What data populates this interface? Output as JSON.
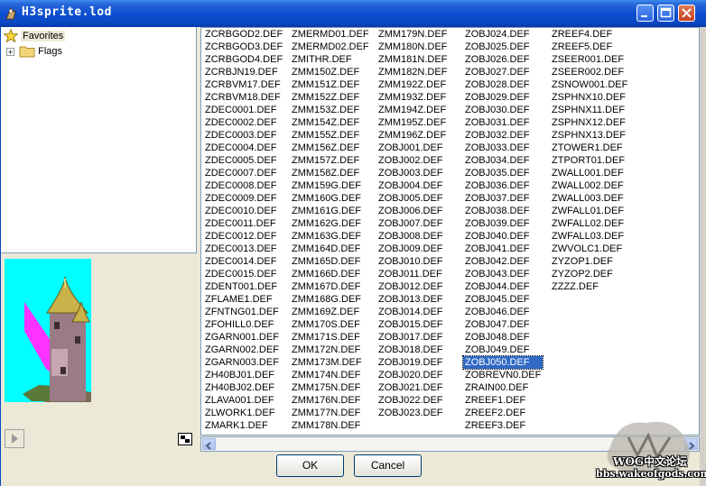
{
  "window": {
    "title": "H3sprite.lod"
  },
  "tree": {
    "favorites_label": "Favorites",
    "flags_label": "Flags",
    "expander": "+"
  },
  "files": {
    "columns": [
      [
        "ZCRBGOD2.DEF",
        "ZCRBGOD3.DEF",
        "ZCRBGOD4.DEF",
        "ZCRBJN19.DEF",
        "ZCRBVM17.DEF",
        "ZCRBVM18.DEF",
        "ZDEC0001.DEF",
        "ZDEC0002.DEF",
        "ZDEC0003.DEF",
        "ZDEC0004.DEF",
        "ZDEC0005.DEF",
        "ZDEC0007.DEF",
        "ZDEC0008.DEF",
        "ZDEC0009.DEF",
        "ZDEC0010.DEF",
        "ZDEC0011.DEF",
        "ZDEC0012.DEF",
        "ZDEC0013.DEF",
        "ZDEC0014.DEF",
        "ZDEC0015.DEF",
        "ZDENT001.DEF",
        "ZFLAME1.DEF",
        "ZFNTNG01.DEF",
        "ZFOHILL0.DEF",
        "ZGARN001.DEF",
        "ZGARN002.DEF",
        "ZGARN003.DEF",
        "ZH40BJ01.DEF",
        "ZH40BJ02.DEF",
        "ZLAVA001.DEF",
        "ZLWORK1.DEF",
        "ZMARK1.DEF"
      ],
      [
        "ZMERMD01.DEF",
        "ZMERMD02.DEF",
        "ZMITHR.DEF",
        "ZMM150Z.DEF",
        "ZMM151Z.DEF",
        "ZMM152Z.DEF",
        "ZMM153Z.DEF",
        "ZMM154Z.DEF",
        "ZMM155Z.DEF",
        "ZMM156Z.DEF",
        "ZMM157Z.DEF",
        "ZMM158Z.DEF",
        "ZMM159G.DEF",
        "ZMM160G.DEF",
        "ZMM161G.DEF",
        "ZMM162G.DEF",
        "ZMM163G.DEF",
        "ZMM164D.DEF",
        "ZMM165D.DEF",
        "ZMM166D.DEF",
        "ZMM167D.DEF",
        "ZMM168G.DEF",
        "ZMM169Z.DEF",
        "ZMM170S.DEF",
        "ZMM171S.DEF",
        "ZMM172N.DEF",
        "ZMM173M.DEF",
        "ZMM174N.DEF",
        "ZMM175N.DEF",
        "ZMM176N.DEF",
        "ZMM177N.DEF",
        "ZMM178N.DEF"
      ],
      [
        "ZMM179N.DEF",
        "ZMM180N.DEF",
        "ZMM181N.DEF",
        "ZMM182N.DEF",
        "ZMM192Z.DEF",
        "ZMM193Z.DEF",
        "ZMM194Z.DEF",
        "ZMM195Z.DEF",
        "ZMM196Z.DEF",
        "ZOBJ001.DEF",
        "ZOBJ002.DEF",
        "ZOBJ003.DEF",
        "ZOBJ004.DEF",
        "ZOBJ005.DEF",
        "ZOBJ006.DEF",
        "ZOBJ007.DEF",
        "ZOBJ008.DEF",
        "ZOBJ009.DEF",
        "ZOBJ010.DEF",
        "ZOBJ011.DEF",
        "ZOBJ012.DEF",
        "ZOBJ013.DEF",
        "ZOBJ014.DEF",
        "ZOBJ015.DEF",
        "ZOBJ017.DEF",
        "ZOBJ018.DEF",
        "ZOBJ019.DEF",
        "ZOBJ020.DEF",
        "ZOBJ021.DEF",
        "ZOBJ022.DEF",
        "ZOBJ023.DEF"
      ],
      [
        "ZOBJ024.DEF",
        "ZOBJ025.DEF",
        "ZOBJ026.DEF",
        "ZOBJ027.DEF",
        "ZOBJ028.DEF",
        "ZOBJ029.DEF",
        "ZOBJ030.DEF",
        "ZOBJ031.DEF",
        "ZOBJ032.DEF",
        "ZOBJ033.DEF",
        "ZOBJ034.DEF",
        "ZOBJ035.DEF",
        "ZOBJ036.DEF",
        "ZOBJ037.DEF",
        "ZOBJ038.DEF",
        "ZOBJ039.DEF",
        "ZOBJ040.DEF",
        "ZOBJ041.DEF",
        "ZOBJ042.DEF",
        "ZOBJ043.DEF",
        "ZOBJ044.DEF",
        "ZOBJ045.DEF",
        "ZOBJ046.DEF",
        "ZOBJ047.DEF",
        "ZOBJ048.DEF",
        "ZOBJ049.DEF",
        "ZOBJ050.DEF",
        "ZOBREVN0.DEF",
        "ZRAIN00.DEF",
        "ZREEF1.DEF",
        "ZREEF2.DEF",
        "ZREEF3.DEF"
      ],
      [
        "ZREEF4.DEF",
        "ZREEF5.DEF",
        "ZSEER001.DEF",
        "ZSEER002.DEF",
        "ZSNOW001.DEF",
        "ZSPHNX10.DEF",
        "ZSPHNX11.DEF",
        "ZSPHNX12.DEF",
        "ZSPHNX13.DEF",
        "ZTOWER1.DEF",
        "ZTPORT01.DEF",
        "ZWALL001.DEF",
        "ZWALL002.DEF",
        "ZWALL003.DEF",
        "ZWFALL01.DEF",
        "ZWFALL02.DEF",
        "ZWFALL03.DEF",
        "ZWVOLC1.DEF",
        "ZYZOP1.DEF",
        "ZYZOP2.DEF",
        "ZZZZ.DEF"
      ]
    ],
    "selected": "ZOBJ050.DEF"
  },
  "buttons": {
    "ok": "OK",
    "cancel": "Cancel"
  },
  "watermark": {
    "line1": "WOG中文论坛",
    "line2": "bbs.wakeofgods.com"
  },
  "colors": {
    "preview_bg": "#00ffff",
    "selection": "#316ac5",
    "titlebar": "#0a47c2"
  },
  "icons": [
    "app-icon",
    "minimize-icon",
    "maximize-icon",
    "close-icon",
    "star-icon",
    "folder-icon",
    "play-icon",
    "scroll-left-icon",
    "scroll-right-icon"
  ]
}
